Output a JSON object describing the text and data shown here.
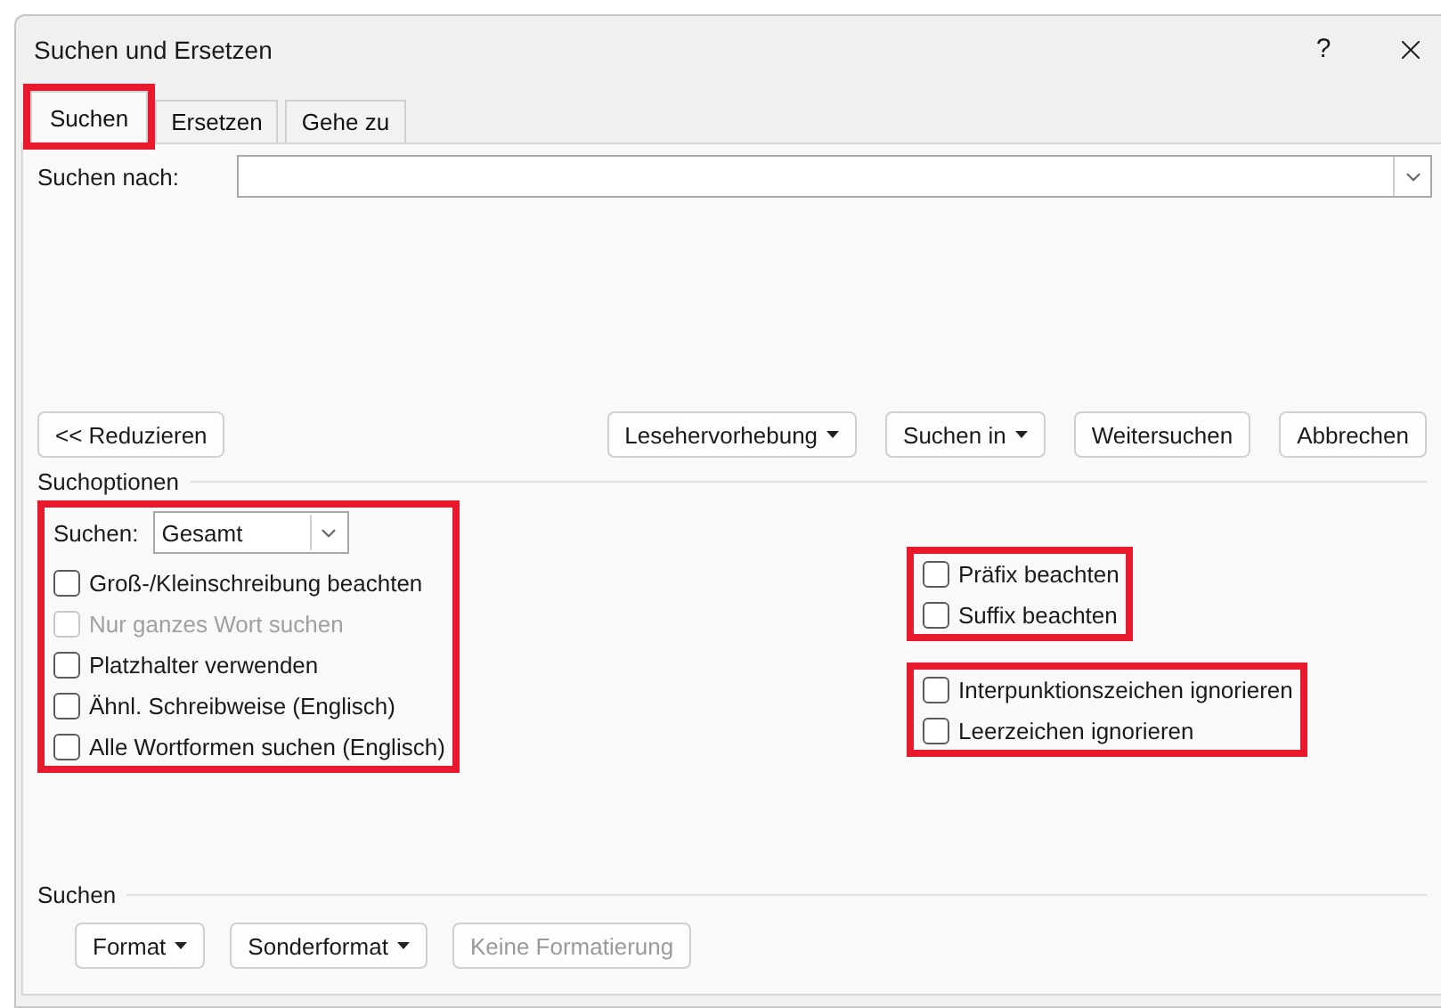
{
  "window": {
    "title": "Suchen und Ersetzen",
    "help": "?"
  },
  "tabs": [
    {
      "label": "Suchen",
      "selected": true,
      "highlighted": true
    },
    {
      "label": "Ersetzen",
      "selected": false,
      "highlighted": false
    },
    {
      "label": "Gehe zu",
      "selected": false,
      "highlighted": false
    }
  ],
  "find": {
    "label": "Suchen nach:"
  },
  "left_buttons": [
    {
      "label": "<< Reduzieren",
      "dropdown": false,
      "disabled": false
    }
  ],
  "right_buttons": [
    {
      "label": "Lesehervorhebung",
      "dropdown": true,
      "disabled": false
    },
    {
      "label": "Suchen in",
      "dropdown": true,
      "disabled": false
    },
    {
      "label": "Weitersuchen",
      "dropdown": false,
      "disabled": false
    },
    {
      "label": "Abbrechen",
      "dropdown": false,
      "disabled": false
    }
  ],
  "options": {
    "title": "Suchoptionen",
    "left_groups": [
      {
        "highlighted": true,
        "items": [
          {
            "kind": "select",
            "label": "Suchen:",
            "value": "Gesamt"
          },
          {
            "kind": "checkbox",
            "label": "Groß-/Kleinschreibung beachten",
            "checked": false,
            "disabled": false
          },
          {
            "kind": "checkbox",
            "label": "Nur ganzes Wort suchen",
            "checked": false,
            "disabled": true
          },
          {
            "kind": "checkbox",
            "label": "Platzhalter verwenden",
            "checked": false,
            "disabled": false
          },
          {
            "kind": "checkbox",
            "label": "Ähnl. Schreibweise (Englisch)",
            "checked": false,
            "disabled": false
          },
          {
            "kind": "checkbox",
            "label": "Alle Wortformen suchen (Englisch)",
            "checked": false,
            "disabled": false
          }
        ]
      }
    ],
    "right_groups": [
      {
        "highlighted": true,
        "items": [
          {
            "kind": "checkbox",
            "label": "Präfix beachten",
            "checked": false,
            "disabled": false
          },
          {
            "kind": "checkbox",
            "label": "Suffix beachten",
            "checked": false,
            "disabled": false
          }
        ]
      },
      {
        "highlighted": true,
        "items": [
          {
            "kind": "checkbox",
            "label": "Interpunktionszeichen ignorieren",
            "checked": false,
            "disabled": false
          },
          {
            "kind": "checkbox",
            "label": "Leerzeichen ignorieren",
            "checked": false,
            "disabled": false
          }
        ]
      }
    ]
  },
  "format": {
    "title": "Suchen",
    "buttons": [
      {
        "label": "Format",
        "dropdown": true,
        "disabled": false
      },
      {
        "label": "Sonderformat",
        "dropdown": true,
        "disabled": false
      },
      {
        "label": "Keine Formatierung",
        "dropdown": false,
        "disabled": true
      }
    ]
  }
}
